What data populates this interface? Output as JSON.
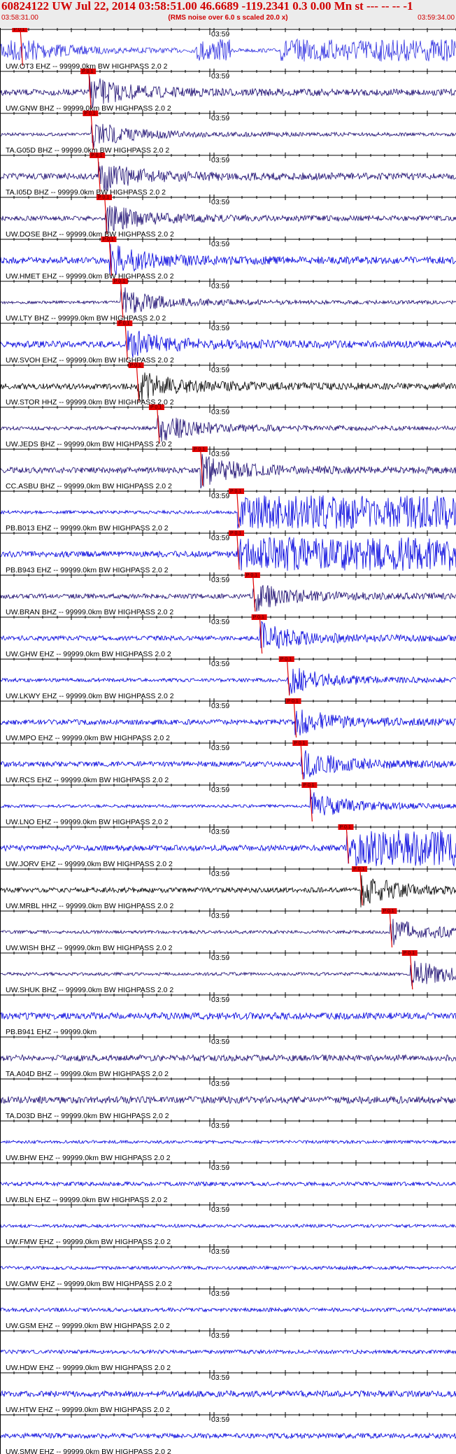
{
  "header": {
    "title": "60824122 UW Jul 22, 2014 03:58:51.00   46.6689 -119.2341  0.3 0.00 Mn st --- -- --   -1",
    "time_start": "03:58:31.00",
    "subtitle": "(RMS noise over 6.0 s scaled 20.0 x)",
    "time_end": "03:59:34.00"
  },
  "minute_label": "03:59",
  "pick_label": "P 0.1",
  "colors": {
    "header_bg": "#ececec",
    "header_text": "#d00000",
    "pick": "#e00000"
  },
  "traces": [
    {
      "label": "UW.OT3 EHZ -- 99999.0km BW  HIGHPASS  2.0  2",
      "color": "#3030e0",
      "pick": 0.045
    },
    {
      "label": "UW.GNW BHZ -- 99999.0km BW  HIGHPASS  2.0  2",
      "color": "#1a0a70",
      "pick": 0.195
    },
    {
      "label": "TA.G05D BHZ -- 99999.0km BW  HIGHPASS  2.0  2",
      "color": "#1a0a70",
      "pick": 0.2
    },
    {
      "label": "TA.I05D BHZ -- 99999.0km BW  HIGHPASS  2.0  2",
      "color": "#1a0a70",
      "pick": 0.215
    },
    {
      "label": "UW.DOSE BHZ -- 99999.0km BW  HIGHPASS  2.0  2",
      "color": "#1a0a70",
      "pick": 0.23
    },
    {
      "label": "UW.HMET EHZ -- 99999.0km BW  HIGHPASS  2.0  2",
      "color": "#0000dd",
      "pick": 0.24
    },
    {
      "label": "UW.LTY BHZ -- 99999.0km BW  HIGHPASS  2.0  2",
      "color": "#1a0a70",
      "pick": 0.265
    },
    {
      "label": "UW.SVOH EHZ -- 99999.0km BW  HIGHPASS  2.0  2",
      "color": "#0000dd",
      "pick": 0.275
    },
    {
      "label": "UW.STOR HHZ -- 99999.0km BW  HIGHPASS  2.0  2",
      "color": "#000000",
      "pick": 0.3
    },
    {
      "label": "UW.JEDS BHZ -- 99999.0km BW  HIGHPASS  2.0  2",
      "color": "#1a0a70",
      "pick": 0.345
    },
    {
      "label": "CC.ASBU BHZ -- 99999.0km BW  HIGHPASS  2.0  2",
      "color": "#1a0a70",
      "pick": 0.44
    },
    {
      "label": "PB.B013 EHZ -- 99999.0km BW  HIGHPASS  2.0  2",
      "color": "#0000dd",
      "pick": 0.52
    },
    {
      "label": "PB.B943 EHZ -- 99999.0km BW  HIGHPASS  2.0  2",
      "color": "#0000dd",
      "pick": 0.52
    },
    {
      "label": "UW.BRAN BHZ -- 99999.0km BW  HIGHPASS  2.0  2",
      "color": "#1a0a70",
      "pick": 0.555
    },
    {
      "label": "UW.GHW EHZ -- 99999.0km BW  HIGHPASS  2.0  2",
      "color": "#0000dd",
      "pick": 0.57
    },
    {
      "label": "UW.LKWY EHZ -- 99999.0km BW  HIGHPASS  2.0  2",
      "color": "#0000dd",
      "pick": 0.63
    },
    {
      "label": "UW.MPO EHZ -- 99999.0km BW  HIGHPASS  2.0  2",
      "color": "#0000dd",
      "pick": 0.645
    },
    {
      "label": "UW.RCS EHZ -- 99999.0km BW  HIGHPASS  2.0  2",
      "color": "#0000dd",
      "pick": 0.66
    },
    {
      "label": "UW.LNO EHZ -- 99999.0km BW  HIGHPASS  2.0  2",
      "color": "#0000dd",
      "pick": 0.68
    },
    {
      "label": "UW.JORV EHZ -- 99999.0km BW  HIGHPASS  2.0  2",
      "color": "#0000dd",
      "pick": 0.76
    },
    {
      "label": "UW.MRBL HHZ -- 99999.0km BW  HIGHPASS  2.0  2",
      "color": "#000000",
      "pick": 0.79
    },
    {
      "label": "UW.WISH BHZ -- 99999.0km BW  HIGHPASS  2.0  2",
      "color": "#1a0a70",
      "pick": 0.855
    },
    {
      "label": "UW.SHUK BHZ -- 99999.0km BW  HIGHPASS  2.0  2",
      "color": "#1a0a70",
      "pick": 0.9
    },
    {
      "label": "PB.B941 EHZ -- 99999.0km",
      "color": "#0000dd",
      "pick": null
    },
    {
      "label": "TA.A04D BHZ -- 99999.0km BW  HIGHPASS  2.0  2",
      "color": "#1a0a70",
      "pick": null
    },
    {
      "label": "TA.D03D BHZ -- 99999.0km BW  HIGHPASS  2.0  2",
      "color": "#1a0a70",
      "pick": null
    },
    {
      "label": "UW.BHW EHZ -- 99999.0km BW  HIGHPASS  2.0  2",
      "color": "#0000dd",
      "pick": null
    },
    {
      "label": "UW.BLN EHZ -- 99999.0km BW  HIGHPASS  2.0  2",
      "color": "#0000dd",
      "pick": null
    },
    {
      "label": "UW.FMW EHZ -- 99999.0km BW  HIGHPASS  2.0  2",
      "color": "#0000dd",
      "pick": null
    },
    {
      "label": "UW.GMW EHZ -- 99999.0km BW  HIGHPASS  2.0  2",
      "color": "#0000dd",
      "pick": null
    },
    {
      "label": "UW.GSM EHZ -- 99999.0km BW  HIGHPASS  2.0  2",
      "color": "#0000dd",
      "pick": null
    },
    {
      "label": "UW.HDW EHZ -- 99999.0km BW  HIGHPASS  2.0  2",
      "color": "#0000dd",
      "pick": null
    },
    {
      "label": "UW.HTW EHZ -- 99999.0km BW  HIGHPASS  2.0  2",
      "color": "#0000dd",
      "pick": null
    },
    {
      "label": "UW.SMW EHZ -- 99999.0km BW  HIGHPASS  2.0  2",
      "color": "#0000dd",
      "pick": null
    }
  ]
}
